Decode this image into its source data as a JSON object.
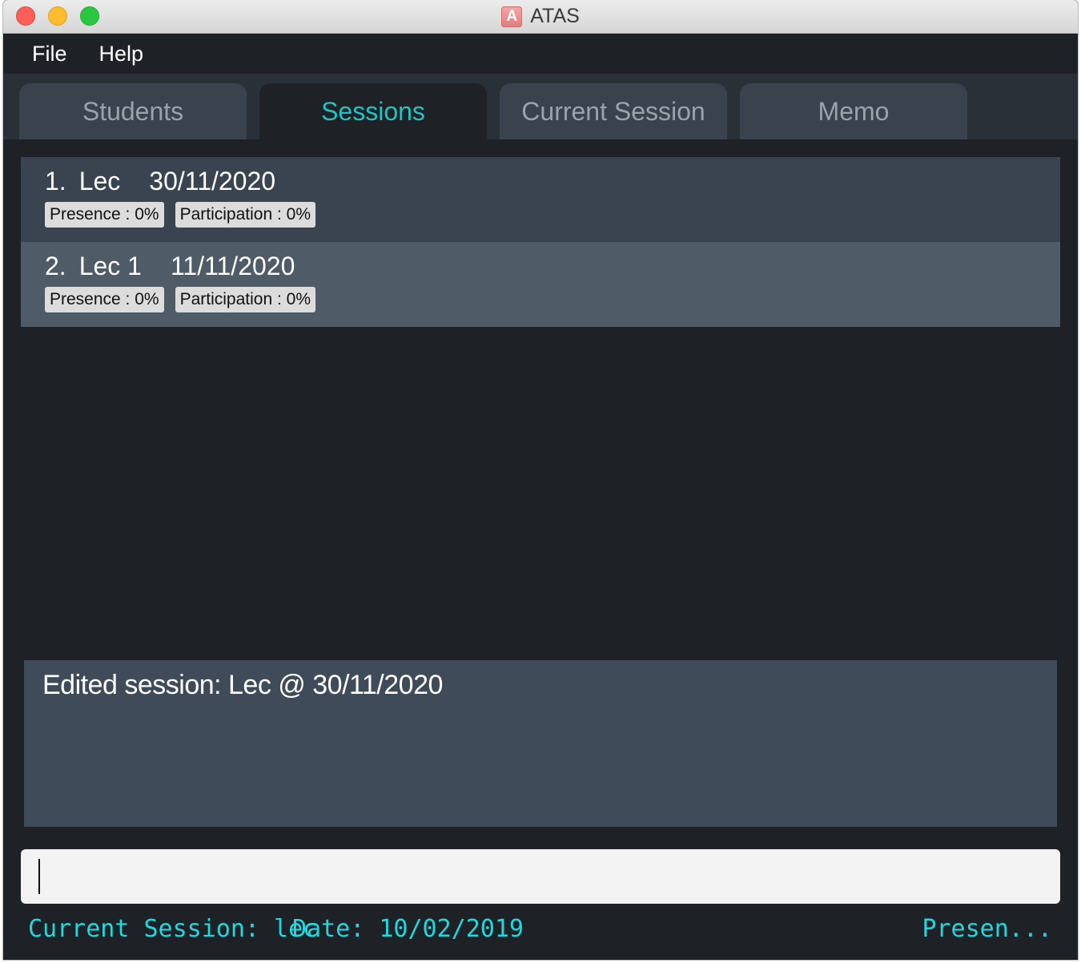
{
  "window": {
    "title": "ATAS",
    "app_icon_letter": "A"
  },
  "menu": {
    "file": "File",
    "help": "Help"
  },
  "tabs": [
    {
      "label": "Students",
      "active": false
    },
    {
      "label": "Sessions",
      "active": true
    },
    {
      "label": "Current Session",
      "active": false
    },
    {
      "label": "Memo",
      "active": false
    }
  ],
  "sessions": [
    {
      "index": "1.",
      "name": "Lec",
      "date": "30/11/2020",
      "presence": "Presence : 0%",
      "participation": "Participation : 0%"
    },
    {
      "index": "2.",
      "name": "Lec 1",
      "date": "11/11/2020",
      "presence": "Presence : 0%",
      "participation": "Participation : 0%"
    }
  ],
  "result": {
    "message": "Edited session: Lec @ 30/11/2020"
  },
  "command": {
    "value": ""
  },
  "status": {
    "current_session": "Current Session: lec",
    "date": "Date: 10/02/2019",
    "right": "Presen..."
  },
  "colors": {
    "accent": "#1fc4c4",
    "status_text": "#1fd8e0",
    "background": "#1e2126"
  }
}
